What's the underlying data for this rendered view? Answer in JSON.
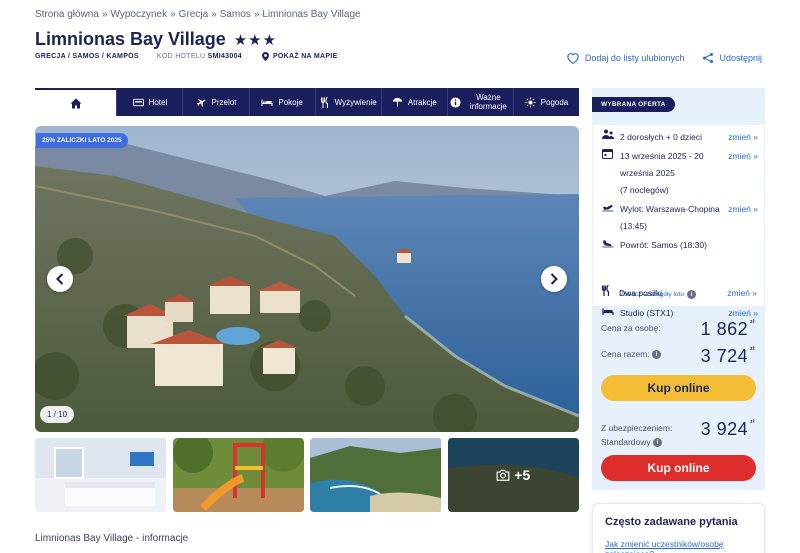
{
  "breadcrumb": [
    "Strona główna",
    "Wypoczynek",
    "Grecja",
    "Samos",
    "Limnionas Bay Village"
  ],
  "breadcrumb_separator": "»",
  "hotel": {
    "name": "Limnionas Bay Village",
    "stars": "★★★",
    "location": "GRECJA / SAMOS / KAMPOS",
    "code_label": "KOD HOTELU",
    "code": "SMI43004",
    "map_label": "POKAŻ NA MAPIE"
  },
  "actions": {
    "favorite": "Dodaj do listy ulubionych",
    "share": "Udostępnij"
  },
  "nav": {
    "home_icon": "home-icon",
    "items": [
      {
        "label": "Hotel",
        "icon": "bed-icon"
      },
      {
        "label": "Przelot",
        "icon": "plane-icon"
      },
      {
        "label": "Pokoje",
        "icon": "bed-icon"
      },
      {
        "label": "Wyżywienie",
        "icon": "cutlery-icon"
      },
      {
        "label": "Atrakcje",
        "icon": "umbrella-icon"
      },
      {
        "label": "Ważne informacje",
        "icon": "info-icon"
      },
      {
        "label": "Pogoda",
        "icon": "sun-icon"
      }
    ]
  },
  "gallery": {
    "promo": "25% ZALICZKI LATO 2025",
    "counter": "1 / 10",
    "more_count": "+5"
  },
  "info_heading": "Limnionas Bay Village - informacje",
  "offer": {
    "tag": "WYBRANA OFERTA",
    "change_label": "zmień »",
    "travelers": "2 dorosłych + 0 dzieci",
    "dates": "13 września 2025 - 20 września 2025",
    "nights": "(7 noclegów)",
    "departure": "Wylot: Warszawa-Chopina (13:45)",
    "return": "Powrót: Samos (18:30)",
    "flight_details": "Zobacz szczegóły lotu",
    "room": "Studio (STX1)",
    "board": "Dwa posiłki",
    "price_per_person_label": "Cena za osobę:",
    "price_per_person": "1 862",
    "price_total_label": "Cena razem:",
    "price_total": "3 724",
    "currency": "zł",
    "buy_label": "Kup online",
    "insurance_label": "Z ubezpieczeniem:",
    "insurance_type": "Standardowy",
    "price_insured": "3 924"
  },
  "faq": {
    "title": "Często zadawane pytania",
    "question": "Jak zmienić uczestników/osobę zgłaszającą?"
  },
  "colors": {
    "navy": "#1b1e5c",
    "accent_blue": "#2a6ad1",
    "offer_bg": "#e6f1fc",
    "buy_yellow": "#f4bd36",
    "buy_red": "#dd2d2d"
  }
}
